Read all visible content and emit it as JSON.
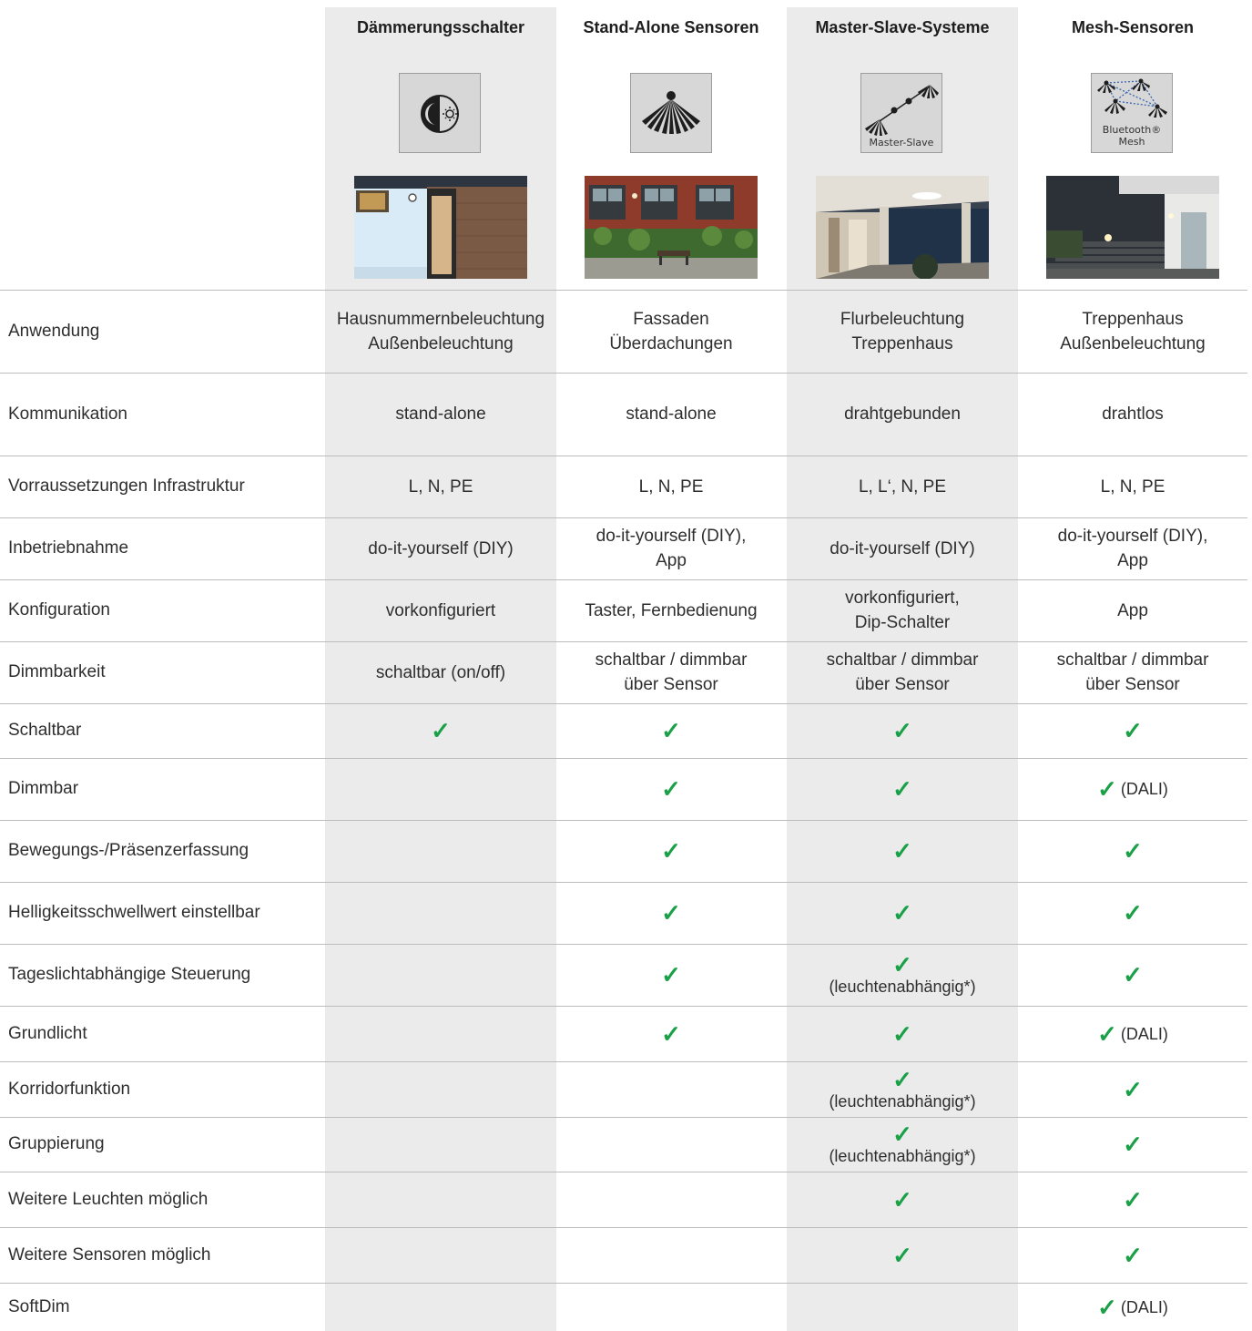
{
  "columns": [
    {
      "title": "Dämmerungsschalter",
      "icon": "day-night-icon",
      "photo": "house-entrance-photo"
    },
    {
      "title": "Stand-Alone Sensoren",
      "icon": "sensor-fan-icon",
      "photo": "brick-facade-photo"
    },
    {
      "title": "Master-Slave-Systeme",
      "icon": "master-slave-icon",
      "icon_label": "Master-Slave",
      "photo": "corridor-photo"
    },
    {
      "title": "Mesh-Sensoren",
      "icon": "bluetooth-mesh-icon",
      "icon_label_1": "Bluetooth®",
      "icon_label_2": "Mesh",
      "photo": "stairway-photo"
    }
  ],
  "rows": [
    {
      "label": "Anwendung",
      "cells": [
        {
          "lines": [
            "Hausnummernbeleuchtung",
            "Außenbeleuchtung"
          ]
        },
        {
          "lines": [
            "Fassaden",
            "Überdachungen"
          ]
        },
        {
          "lines": [
            "Flurbeleuchtung",
            "Treppenhaus"
          ]
        },
        {
          "lines": [
            "Treppenhaus",
            "Außenbeleuchtung"
          ]
        }
      ]
    },
    {
      "label": "Kommunikation",
      "cells": [
        {
          "lines": [
            "stand-alone"
          ]
        },
        {
          "lines": [
            "stand-alone"
          ]
        },
        {
          "lines": [
            "drahtgebunden"
          ]
        },
        {
          "lines": [
            "drahtlos"
          ]
        }
      ]
    },
    {
      "label": "Vorraussetzungen Infrastruktur",
      "cells": [
        {
          "lines": [
            "L, N, PE"
          ]
        },
        {
          "lines": [
            "L, N, PE"
          ]
        },
        {
          "lines": [
            "L, L‘, N, PE"
          ]
        },
        {
          "lines": [
            "L, N, PE"
          ]
        }
      ]
    },
    {
      "label": "Inbetriebnahme",
      "cells": [
        {
          "lines": [
            "do-it-yourself (DIY)"
          ]
        },
        {
          "lines": [
            "do-it-yourself (DIY),",
            "App"
          ]
        },
        {
          "lines": [
            "do-it-yourself (DIY)"
          ]
        },
        {
          "lines": [
            "do-it-yourself (DIY),",
            "App"
          ]
        }
      ]
    },
    {
      "label": "Konfiguration",
      "cells": [
        {
          "lines": [
            "vorkonfiguriert"
          ]
        },
        {
          "lines": [
            "Taster, Fernbedienung"
          ]
        },
        {
          "lines": [
            "vorkonfiguriert,",
            "Dip-Schalter"
          ]
        },
        {
          "lines": [
            "App"
          ]
        }
      ]
    },
    {
      "label": "Dimmbarkeit",
      "cells": [
        {
          "lines": [
            "schaltbar (on/off)"
          ]
        },
        {
          "lines": [
            "schaltbar / dimmbar",
            "über Sensor"
          ]
        },
        {
          "lines": [
            "schaltbar / dimmbar",
            "über Sensor"
          ]
        },
        {
          "lines": [
            "schaltbar / dimmbar",
            "über Sensor"
          ]
        }
      ]
    },
    {
      "label": "Schaltbar",
      "cells": [
        {
          "check": true
        },
        {
          "check": true
        },
        {
          "check": true
        },
        {
          "check": true
        }
      ]
    },
    {
      "label": "Dimmbar",
      "cells": [
        {},
        {
          "check": true
        },
        {
          "check": true
        },
        {
          "check": true,
          "note": "(DALI)"
        }
      ]
    },
    {
      "label": "Bewegungs-/Präsenzerfassung",
      "cells": [
        {},
        {
          "check": true
        },
        {
          "check": true
        },
        {
          "check": true
        }
      ]
    },
    {
      "label": "Helligkeitsschwellwert einstellbar",
      "cells": [
        {},
        {
          "check": true
        },
        {
          "check": true
        },
        {
          "check": true
        }
      ]
    },
    {
      "label": "Tageslichtabhängige Steuerung",
      "cells": [
        {},
        {
          "check": true
        },
        {
          "check": true,
          "subnote": "(leuchtenabhängig*)"
        },
        {
          "check": true
        }
      ]
    },
    {
      "label": "Grundlicht",
      "cells": [
        {},
        {
          "check": true
        },
        {
          "check": true
        },
        {
          "check": true,
          "note": "(DALI)"
        }
      ]
    },
    {
      "label": "Korridorfunktion",
      "cells": [
        {},
        {},
        {
          "check": true,
          "subnote": "(leuchtenabhängig*)"
        },
        {
          "check": true
        }
      ]
    },
    {
      "label": "Gruppierung",
      "cells": [
        {},
        {},
        {
          "check": true,
          "subnote": "(leuchtenabhängig*)"
        },
        {
          "check": true
        }
      ]
    },
    {
      "label": "Weitere Leuchten möglich",
      "cells": [
        {},
        {},
        {
          "check": true
        },
        {
          "check": true
        }
      ]
    },
    {
      "label": "Weitere Sensoren möglich",
      "cells": [
        {},
        {},
        {
          "check": true
        },
        {
          "check": true
        }
      ]
    },
    {
      "label": "SoftDim",
      "cells": [
        {},
        {},
        {},
        {
          "check": true,
          "note": "(DALI)"
        }
      ]
    }
  ],
  "check_symbol": "✓",
  "colors": {
    "check": "#1aa047",
    "column_highlight": "#ebebeb",
    "rule": "#bcbcbc"
  }
}
